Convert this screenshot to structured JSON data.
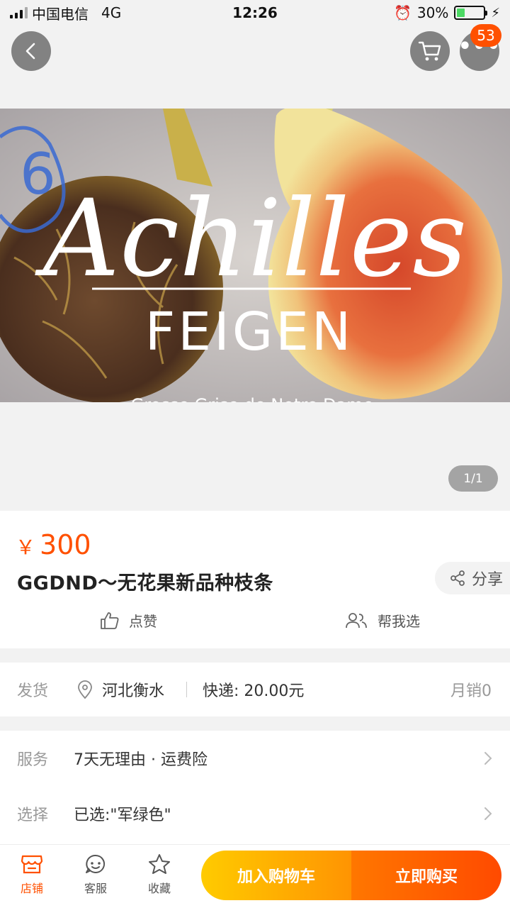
{
  "status_bar": {
    "carrier": "中国电信",
    "network": "4G",
    "time": "12:26",
    "battery": "30%",
    "battery_level": 0.3
  },
  "header": {
    "cart_badge": "53"
  },
  "gallery": {
    "image_title": "Achilles",
    "image_subtitle": "FEIGEN",
    "image_caption": "Grosse Grise de Notre Dame",
    "image_mark": "6",
    "indicator": "1/1"
  },
  "product": {
    "currency": "￥",
    "price": "300",
    "title": "GGDND～无花果新品种枝条",
    "share_label": "分享",
    "like_label": "点赞",
    "help_label": "帮我选"
  },
  "shipping": {
    "label": "发货",
    "location": "河北衡水",
    "fee": "快递: 20.00元",
    "monthly_sales": "月销0"
  },
  "service": {
    "label": "服务",
    "value": "7天无理由 · 运费险"
  },
  "selection": {
    "label": "选择",
    "value": "已选:\"军绿色\""
  },
  "bottom_bar": {
    "shop_label": "店铺",
    "service_label": "客服",
    "favorite_label": "收藏",
    "add_cart_label": "加入购物车",
    "buy_now_label": "立即购买"
  },
  "colors": {
    "accent": "#ff5000",
    "add_cart": "#ffb000",
    "buy_now": "#ff5a00"
  }
}
